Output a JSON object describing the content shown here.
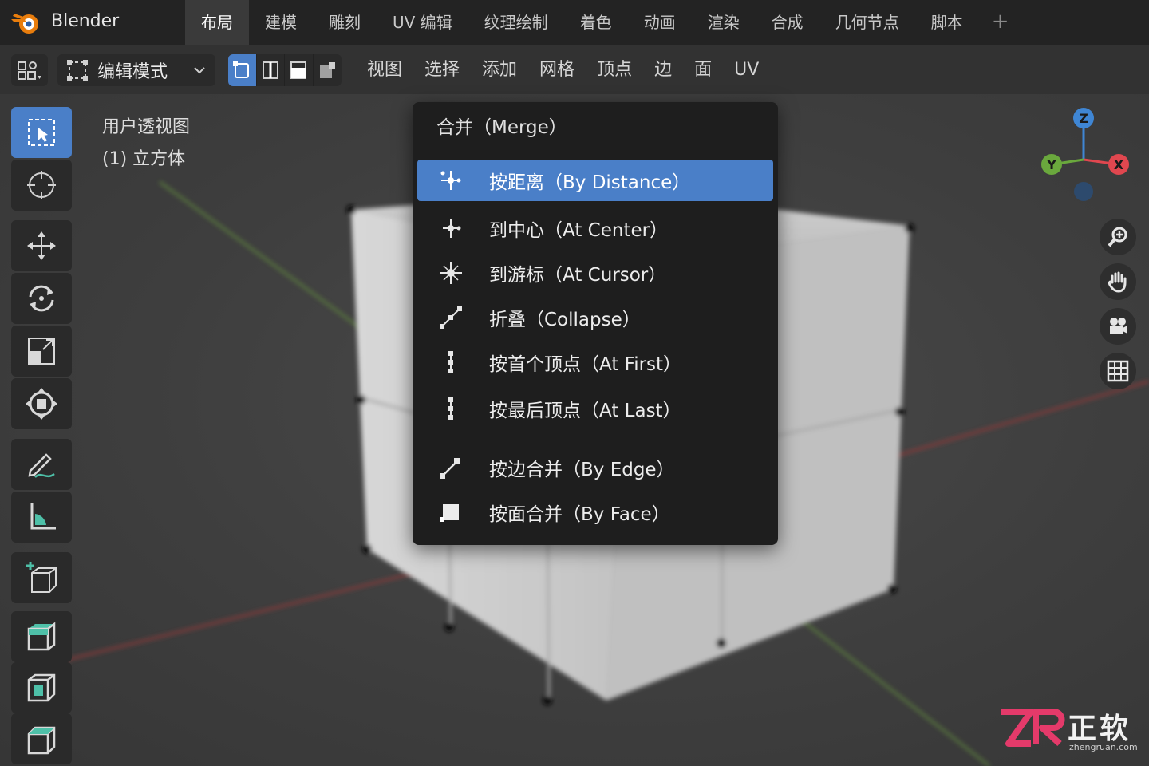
{
  "app": {
    "name": "Blender"
  },
  "workspace_tabs": [
    {
      "label": "布局",
      "active": true
    },
    {
      "label": "建模",
      "active": false
    },
    {
      "label": "雕刻",
      "active": false
    },
    {
      "label": "UV 编辑",
      "active": false
    },
    {
      "label": "纹理绘制",
      "active": false
    },
    {
      "label": "着色",
      "active": false
    },
    {
      "label": "动画",
      "active": false
    },
    {
      "label": "渲染",
      "active": false
    },
    {
      "label": "合成",
      "active": false
    },
    {
      "label": "几何节点",
      "active": false
    },
    {
      "label": "脚本",
      "active": false
    }
  ],
  "add_workspace": "+",
  "header": {
    "mode": "编辑模式",
    "menus": [
      "视图",
      "选择",
      "添加",
      "网格",
      "顶点",
      "边",
      "面",
      "UV"
    ]
  },
  "viewport": {
    "view_name": "用户透视图",
    "object_name": "(1) 立方体"
  },
  "gizmo": {
    "z_label": "Z",
    "y_label": "Y",
    "x_label": "X"
  },
  "merge_menu": {
    "title": "合并（Merge）",
    "items": [
      {
        "label": "按距离（By Distance）",
        "icon": "merge-distance-icon",
        "highlighted": true
      },
      {
        "label": "到中心（At Center）",
        "icon": "merge-center-icon",
        "highlighted": false
      },
      {
        "label": "到游标（At Cursor）",
        "icon": "merge-cursor-icon",
        "highlighted": false
      },
      {
        "label": "折叠（Collapse）",
        "icon": "collapse-icon",
        "highlighted": false
      },
      {
        "label": "按首个顶点（At First）",
        "icon": "vertex-first-icon",
        "highlighted": false
      },
      {
        "label": "按最后顶点（At Last）",
        "icon": "vertex-last-icon",
        "highlighted": false
      },
      {
        "label": "按边合并（By Edge）",
        "icon": "edge-merge-icon",
        "highlighted": false
      },
      {
        "label": "按面合并（By Face）",
        "icon": "face-merge-icon",
        "highlighted": false
      }
    ]
  },
  "watermark": {
    "brand": "正软",
    "domain": "zhengruan.com"
  },
  "colors": {
    "accent": "#4a7fc8",
    "x_axis": "#e0474f",
    "y_axis": "#6aa83d",
    "z_axis": "#3f86d4"
  }
}
